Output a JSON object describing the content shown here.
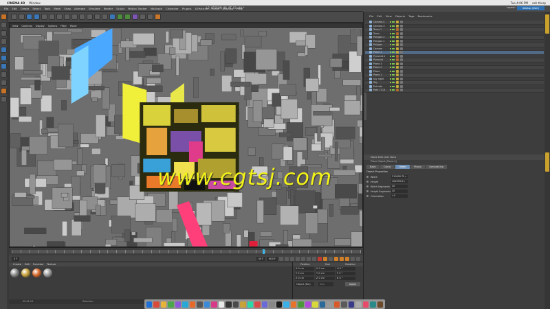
{
  "mac": {
    "apple": "",
    "app_name": "CINEMA 4D",
    "menu": [
      "Window"
    ],
    "right_items": [
      "Tue 4:06 PM",
      "ash thorp"
    ]
  },
  "window": {
    "title": "L2_LESSON_06_AT_03.c4d *",
    "menu": [
      "File",
      "Edit",
      "Create",
      "Select",
      "Tools",
      "Mesh",
      "Snap",
      "Animate",
      "Simulate",
      "Render",
      "Sculpt",
      "Motion Tracker",
      "MoGraph",
      "Character",
      "Plugins",
      "X-Particles",
      "Script",
      "Window",
      "Help"
    ]
  },
  "viewport": {
    "menu": [
      "View",
      "Cameras",
      "Display",
      "Options",
      "Filter",
      "Panel"
    ],
    "watermark": "www.cgtsj.com"
  },
  "transport": {
    "start": "0 F",
    "current": "40 F",
    "end": "600 F"
  },
  "materials": {
    "menu": [
      "Create",
      "Edit",
      "Function",
      "Texture"
    ],
    "swatches": [
      "#8a8a8a",
      "#c7a23a",
      "#d86a2a",
      "#9a9a9a"
    ]
  },
  "coords": {
    "headers": [
      "Position",
      "Size",
      "Rotation"
    ],
    "rows": [
      [
        "X  0 cm",
        "X  0 cm",
        "H  0 °"
      ],
      [
        "Y  0 cm",
        "Y  0 cm",
        "P  0 °"
      ],
      [
        "Z  0 cm",
        "Z  0 cm",
        "B  0 °"
      ]
    ],
    "mode": "Object (Rel)",
    "size_mode": "Size",
    "apply": "Apply"
  },
  "status": {
    "time": "00:01:19",
    "message": "Selection"
  },
  "right": {
    "top_menu": [
      "File",
      "Edit",
      "View",
      "Objects",
      "Tags",
      "Bookmarks"
    ],
    "layout_label": "Layout:",
    "layout_value": "Startup (User)",
    "objects": [
      {
        "name": "Camera.4",
        "sel": false,
        "tag": "#c5a93a"
      },
      {
        "name": "Camera.3",
        "sel": false,
        "tag": "#c5a93a"
      },
      {
        "name": "Torus.1",
        "sel": false,
        "tag": "#b86a2a"
      },
      {
        "name": "Torus",
        "sel": false,
        "tag": "#b86a2a"
      },
      {
        "name": "Polygon.2",
        "sel": false,
        "tag": "#c5a93a"
      },
      {
        "name": "Polygon.1",
        "sel": false,
        "tag": "#c5a93a"
      },
      {
        "name": "Polygon",
        "sel": false,
        "tag": "#c5a93a"
      },
      {
        "name": "Camera",
        "sel": false,
        "tag": "#c5a93a"
      },
      {
        "name": "Plane.4",
        "sel": true,
        "tag": "#c5a93a"
      },
      {
        "name": "Pyramid.1",
        "sel": false,
        "tag": "#b86a2a"
      },
      {
        "name": "Pyramid",
        "sel": false,
        "tag": "#b86a2a"
      },
      {
        "name": "Plane.3",
        "sel": false,
        "tag": "#c5a93a"
      },
      {
        "name": "Plane.2",
        "sel": false,
        "tag": "#c5a93a"
      },
      {
        "name": "Plane",
        "sel": false,
        "tag": "#c5a93a"
      },
      {
        "name": "Plane.1",
        "sel": false,
        "tag": "#c5a93a"
      },
      {
        "name": "sky night",
        "sel": false,
        "tag": "#c5a93a"
      },
      {
        "name": "Sky",
        "sel": false,
        "tag": "#c5a93a"
      },
      {
        "name": "Extrude",
        "sel": false,
        "tag": "#c5a93a"
      },
      {
        "name": "Path 7113",
        "sel": false,
        "tag": "#b86a2a"
      }
    ],
    "attr_header": "Mode   Edit   User Data",
    "attr_sub": "Plane Object [Plane.4]",
    "attr_tabs": [
      {
        "label": "Basic",
        "active": false
      },
      {
        "label": "Coord.",
        "active": false
      },
      {
        "label": "Object",
        "active": true
      },
      {
        "label": "Phong",
        "active": false
      },
      {
        "label": "Compositing",
        "active": false
      }
    ],
    "section": "Object Properties",
    "fields": [
      {
        "label": "Width",
        "value": "210000.79 c"
      },
      {
        "label": "Height",
        "value": "102393.5 c"
      },
      {
        "label": "Width Segments",
        "value": "20"
      },
      {
        "label": "Height Segments",
        "value": "20"
      },
      {
        "label": "Orientation",
        "value": "+Y"
      }
    ]
  }
}
